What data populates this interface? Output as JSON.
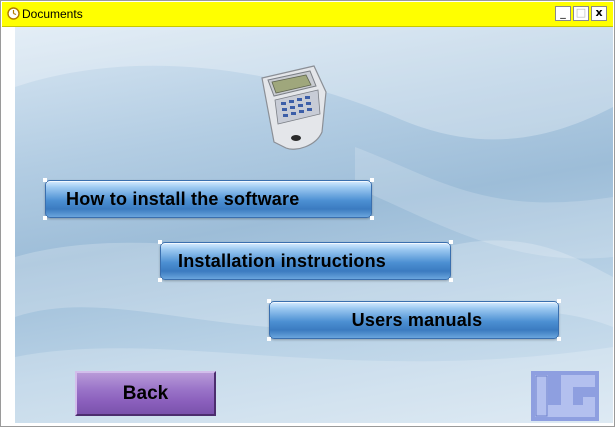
{
  "window": {
    "title": "Documents",
    "controls": {
      "minimize": "_",
      "maximize": "□",
      "close": "x"
    }
  },
  "menu": {
    "items": [
      {
        "label": "How to install the software"
      },
      {
        "label": "Installation instructions"
      },
      {
        "label": "Users manuals"
      }
    ]
  },
  "footer": {
    "back_label": "Back"
  },
  "colors": {
    "titlebar": "#ffff00",
    "menu_button": "#4b8fd2",
    "back_button": "#8a5fbc",
    "logo": "#8e9fe0"
  },
  "icons": {
    "app": "clock-icon",
    "device": "card-terminal-image",
    "logo": "lg-logo"
  }
}
